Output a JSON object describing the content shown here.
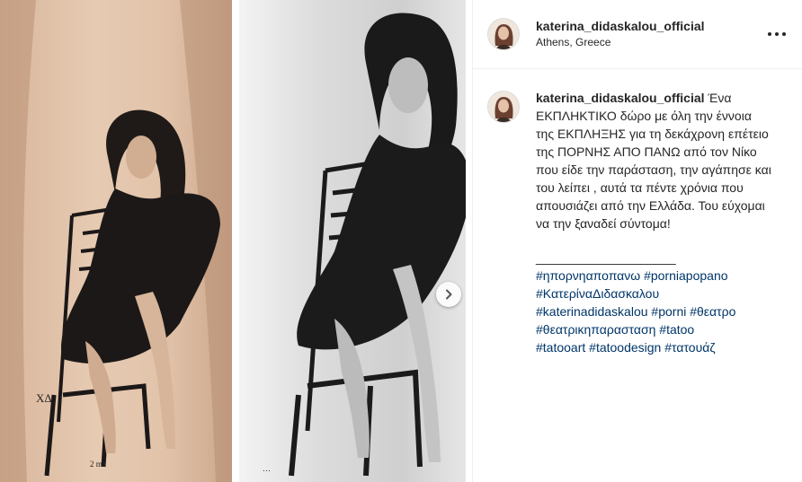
{
  "header": {
    "username": "katerina_didaskalou_official",
    "location": "Athens, Greece",
    "more_icon": "more-horizontal-icon"
  },
  "caption": {
    "username": "katerina_didaskalou_official",
    "text": "Ένα ΕΚΠΛΗΚΤΙΚΟ δώρο με όλη την έννοια της ΕΚΠΛΗΞΗΣ για τη δεκάχρονη επέτειο της ΠΟΡΝΗΣ ΑΠΟ ΠΑΝΩ από τον Νίκο που είδε την παράσταση, την αγάπησε και του λείπει , αυτά τα πέντε χρόνια που απουσιάζει από την Ελλάδα. Του εύχομαι να την ξαναδεί σύντομα!",
    "divider": "____________________",
    "hashtags": [
      "#ηπορνηαποπανω",
      "#porniapopano",
      "#ΚατερίναΔιδασκαλου",
      "#katerinadidaskalou",
      "#porni",
      "#θεατρο",
      "#θεατρικηπαρασταση",
      "#tatoo",
      "#tatooart",
      "#tatoodesign",
      "#τατουάζ"
    ]
  },
  "media": {
    "next_icon": "chevron-right-icon",
    "tattoo_initials": "ΧΔ",
    "tattoo_date": "2 ma"
  },
  "colors": {
    "hashtag": "#003569",
    "text": "#262626",
    "border": "#efefef"
  }
}
